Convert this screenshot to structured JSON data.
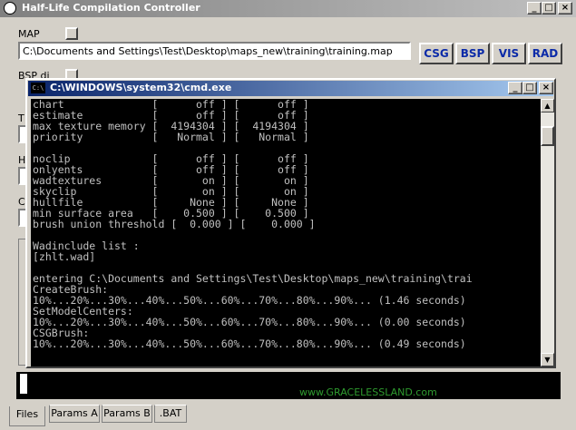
{
  "app": {
    "title": "Half-Life Compilation Controller",
    "map_label": "MAP",
    "map_path": "C:\\Documents and Settings\\Test\\Desktop\\maps_new\\training\\training.map",
    "bsp_label": "BSP di",
    "buttons": {
      "csg": "CSG",
      "bsp": "BSP",
      "vis": "VIS",
      "rad": "RAD"
    },
    "hidden_labels": {
      "t": "T",
      "h": "H",
      "c": "C",
      "c2": "C"
    },
    "footer_text": "www.GRACELESSLAND.com",
    "tabs": [
      "Files",
      "Params A",
      "Params B",
      ".BAT"
    ]
  },
  "cmd": {
    "title": "C:\\WINDOWS\\system32\\cmd.exe",
    "icon_label": "C:\\",
    "lines": [
      "chart              [      off ] [      off ]",
      "estimate           [      off ] [      off ]",
      "max texture memory [  4194304 ] [  4194304 ]",
      "priority           [   Normal ] [   Normal ]",
      "",
      "noclip             [      off ] [      off ]",
      "onlyents           [      off ] [      off ]",
      "wadtextures        [       on ] [       on ]",
      "skyclip            [       on ] [       on ]",
      "hullfile           [     None ] [     None ]",
      "min surface area   [    0.500 ] [    0.500 ]",
      "brush union threshold [  0.000 ] [    0.000 ]",
      "",
      "Wadinclude list :",
      "[zhlt.wad]",
      "",
      "entering C:\\Documents and Settings\\Test\\Desktop\\maps_new\\training\\trai",
      "CreateBrush:",
      "10%...20%...30%...40%...50%...60%...70%...80%...90%... (1.46 seconds)",
      "SetModelCenters:",
      "10%...20%...30%...40%...50%...60%...70%...80%...90%... (0.00 seconds)",
      "CSGBrush:",
      "10%...20%...30%...40%...50%...60%...70%...80%...90%... (0.49 seconds)"
    ]
  }
}
